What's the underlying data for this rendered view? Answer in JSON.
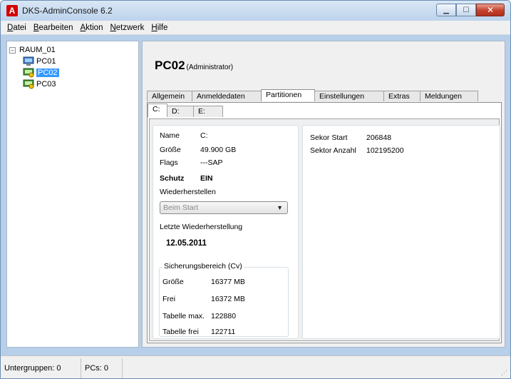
{
  "window": {
    "title": "DKS-AdminConsole 6.2",
    "app_icon": "A"
  },
  "menu": [
    {
      "key": "D",
      "rest": "atei"
    },
    {
      "key": "B",
      "rest": "earbeiten"
    },
    {
      "key": "A",
      "rest": "ktion"
    },
    {
      "key": "N",
      "rest": "etzwerk"
    },
    {
      "key": "H",
      "rest": "ilfe"
    }
  ],
  "tree": {
    "root": "RAUM_01",
    "items": [
      "PC01",
      "PC02",
      "PC03"
    ],
    "selected": "PC02"
  },
  "header": {
    "pc_name": "PC02",
    "role": "(Administrator)"
  },
  "tabs": [
    "Allgemein",
    "Anmeldedaten",
    "Partitionen",
    "Einstellungen",
    "Extras",
    "Meldungen"
  ],
  "active_tab": "Partitionen",
  "subtabs": [
    "C:",
    "D:",
    "E:"
  ],
  "active_subtab": "C:",
  "partition": {
    "name_label": "Name",
    "name_value": "C:",
    "size_label": "Größe",
    "size_value": "49.900 GB",
    "flags_label": "Flags",
    "flags_value": "---SAP",
    "protect_label": "Schutz",
    "protect_value": "EIN",
    "restore_label": "Wiederherstellen",
    "restore_option": "Beim Start",
    "last_restore_label": "Letzte Wiederherstellung",
    "last_restore_value": "12.05.2011",
    "backup": {
      "title": "Sicherungsbereich (Cv)",
      "size_label": "Größe",
      "size_value": "16377 MB",
      "free_label": "Frei",
      "free_value": "16372 MB",
      "table_max_label": "Tabelle max.",
      "table_max_value": "122880",
      "table_free_label": "Tabelle frei",
      "table_free_value": "122711"
    },
    "sector_start_label": "Sekor Start",
    "sector_start_value": "206848",
    "sector_count_label": "Sektor Anzahl",
    "sector_count_value": "102195200"
  },
  "status": {
    "subgroups": "Untergruppen: 0",
    "pcs": "PCs: 0"
  }
}
